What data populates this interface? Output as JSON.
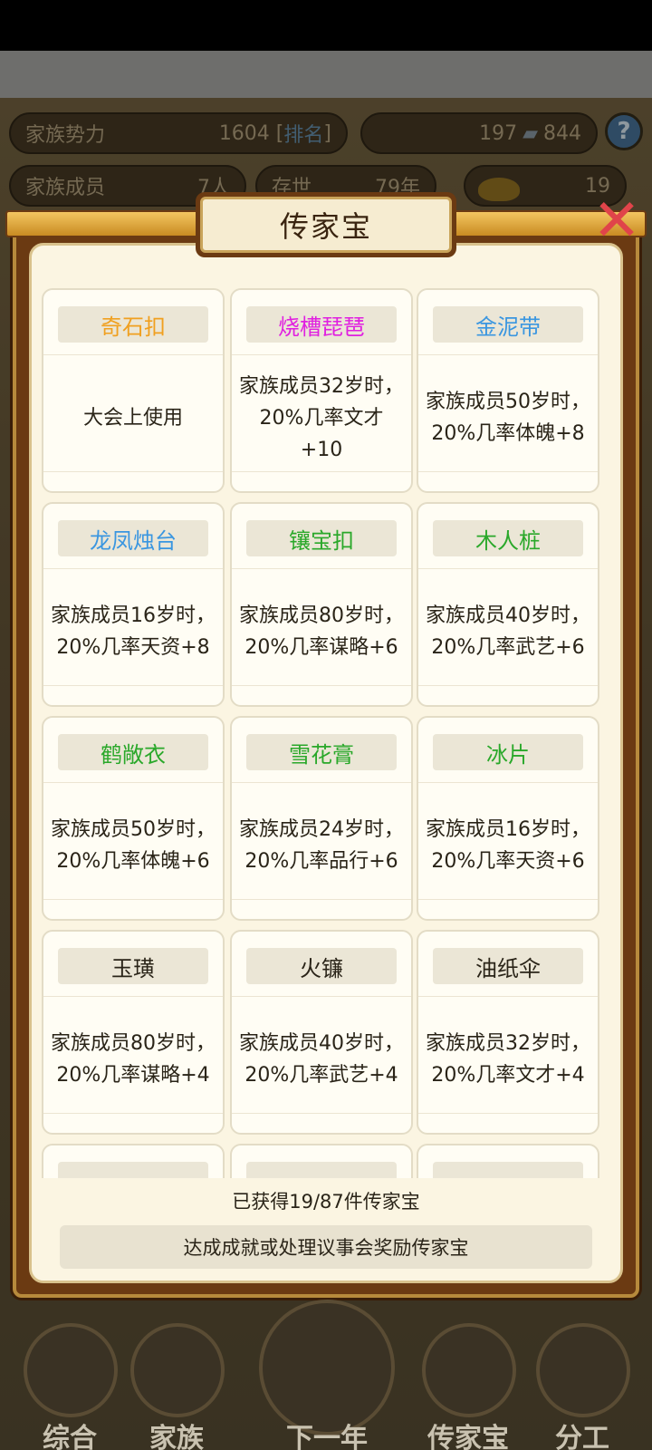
{
  "background": {
    "stats": [
      {
        "label": "家族势力",
        "value": "1604 [",
        "link": "排名",
        "suffix": "]"
      },
      {
        "label": "家族成员",
        "value": "7人"
      },
      {
        "label": "存世",
        "value": "79年"
      }
    ],
    "currency": {
      "a": "197",
      "b": "844"
    },
    "gold": "19",
    "help": "?"
  },
  "dialog": {
    "title": "传家宝",
    "close_glyph": "✕",
    "items": [
      {
        "name": "奇石扣",
        "color": "#f0a020",
        "desc": "大会上使用"
      },
      {
        "name": "烧槽琵琶",
        "color": "#e020e0",
        "desc": "家族成员32岁时，20%几率文才+10"
      },
      {
        "name": "金泥带",
        "color": "#3a96e0",
        "desc": "家族成员50岁时，20%几率体魄+8"
      },
      {
        "name": "龙凤烛台",
        "color": "#3a96e0",
        "desc": "家族成员16岁时，20%几率天资+8"
      },
      {
        "name": "镶宝扣",
        "color": "#2aa82a",
        "desc": "家族成员80岁时，20%几率谋略+6"
      },
      {
        "name": "木人桩",
        "color": "#2aa82a",
        "desc": "家族成员40岁时，20%几率武艺+6"
      },
      {
        "name": "鹤敞衣",
        "color": "#2aa82a",
        "desc": "家族成员50岁时，20%几率体魄+6"
      },
      {
        "name": "雪花膏",
        "color": "#2aa82a",
        "desc": "家族成员24岁时，20%几率品行+6"
      },
      {
        "name": "冰片",
        "color": "#2aa82a",
        "desc": "家族成员16岁时，20%几率天资+6"
      },
      {
        "name": "玉璜",
        "color": "#2a2418",
        "desc": "家族成员80岁时，20%几率谋略+4"
      },
      {
        "name": "火镰",
        "color": "#2a2418",
        "desc": "家族成员40岁时，20%几率武艺+4"
      },
      {
        "name": "油纸伞",
        "color": "#2a2418",
        "desc": "家族成员32岁时，20%几率文才+4"
      }
    ],
    "count_text": "已获得19/87件传家宝",
    "hint_text": "达成成就或处理议事会奖励传家宝"
  },
  "nav": [
    {
      "label": "综合",
      "icon": "scroll-icon"
    },
    {
      "label": "家族",
      "icon": "house-icon"
    },
    {
      "label": "下一年",
      "icon": "mountain-icon"
    },
    {
      "label": "传家宝",
      "icon": "cloud-icon"
    },
    {
      "label": "分工",
      "icon": "person-icon"
    }
  ]
}
